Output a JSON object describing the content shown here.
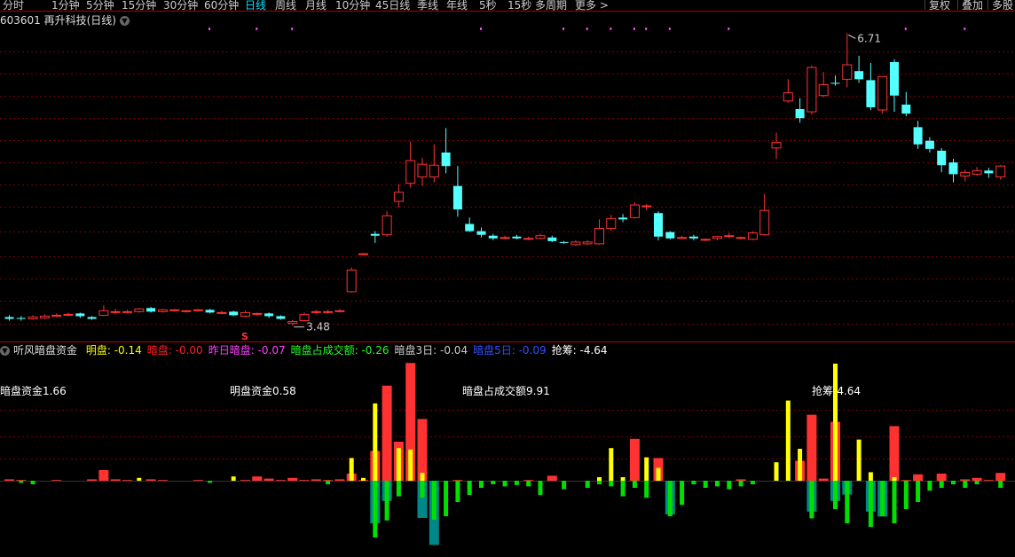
{
  "toolbar": {
    "periods": [
      "分时",
      "1分钟",
      "5分钟",
      "15分钟",
      "30分钟",
      "60分钟",
      "日线",
      "周线",
      "月线",
      "10分钟",
      "45日线",
      "季线",
      "年线",
      "5秒",
      "15秒",
      "多周期",
      "更多 >"
    ],
    "active": "日线",
    "right_buttons": [
      "复权",
      "叠加",
      "多股"
    ]
  },
  "stock": {
    "title": "603601 再升科技(日线)"
  },
  "price_chart": {
    "high_label": "6.71",
    "low_label": "3.48",
    "signal_mark": "S"
  },
  "indicator": {
    "name": "听风暗盘资金",
    "items": [
      {
        "text": "明盘: -0.14",
        "color": "#ffff00"
      },
      {
        "text": "暗盘: -0.00",
        "color": "#ff2020"
      },
      {
        "text": "昨日暗盘: -0.07",
        "color": "#ff40ff"
      },
      {
        "text": "暗盘占成交额: -0.26",
        "color": "#20ff20"
      },
      {
        "text": "暗盘3日: -0.04",
        "color": "#cccccc"
      },
      {
        "text": "暗盘5日: -0.09",
        "color": "#3050ff"
      },
      {
        "text": "抢筹: -4.64",
        "color": "#ffffff"
      }
    ],
    "annotations": [
      "暗盘资金1.66",
      "明盘资金0.58",
      "暗盘占成交额9.91",
      "抢筹-4.64"
    ]
  },
  "colors": {
    "up": "#ff3232",
    "down": "#54ffff",
    "grid": "#7a0000",
    "border": "#b00000",
    "yellow": "#ffff00",
    "green": "#00e000",
    "teal": "#008888"
  },
  "chart_data": [
    {
      "type": "candlestick",
      "title": "603601 再升科技(日线)",
      "ylim": [
        3.3,
        6.9
      ],
      "annotations": [
        {
          "label": "6.71",
          "kind": "high"
        },
        {
          "label": "3.48",
          "kind": "low"
        }
      ],
      "candles": [
        [
          3.57,
          3.55,
          3.59,
          3.53
        ],
        [
          3.56,
          3.55,
          3.58,
          3.53
        ],
        [
          3.55,
          3.57,
          3.59,
          3.54
        ],
        [
          3.56,
          3.58,
          3.6,
          3.55
        ],
        [
          3.58,
          3.59,
          3.61,
          3.57
        ],
        [
          3.6,
          3.6,
          3.62,
          3.58
        ],
        [
          3.61,
          3.58,
          3.62,
          3.56
        ],
        [
          3.57,
          3.55,
          3.58,
          3.54
        ],
        [
          3.59,
          3.64,
          3.7,
          3.58
        ],
        [
          3.63,
          3.63,
          3.66,
          3.6
        ],
        [
          3.63,
          3.63,
          3.65,
          3.61
        ],
        [
          3.63,
          3.66,
          3.67,
          3.62
        ],
        [
          3.67,
          3.63,
          3.68,
          3.62
        ],
        [
          3.63,
          3.65,
          3.66,
          3.62
        ],
        [
          3.65,
          3.65,
          3.66,
          3.63
        ],
        [
          3.63,
          3.64,
          3.65,
          3.62
        ],
        [
          3.64,
          3.65,
          3.66,
          3.63
        ],
        [
          3.65,
          3.62,
          3.66,
          3.61
        ],
        [
          3.62,
          3.62,
          3.64,
          3.6
        ],
        [
          3.63,
          3.59,
          3.64,
          3.58
        ],
        [
          3.58,
          3.62,
          3.64,
          3.57
        ],
        [
          3.6,
          3.61,
          3.62,
          3.58
        ],
        [
          3.61,
          3.58,
          3.62,
          3.56
        ],
        [
          3.58,
          3.55,
          3.59,
          3.54
        ],
        [
          3.5,
          3.52,
          3.54,
          3.48
        ],
        [
          3.53,
          3.6,
          3.62,
          3.52
        ],
        [
          3.62,
          3.63,
          3.65,
          3.6
        ],
        [
          3.63,
          3.63,
          3.65,
          3.61
        ],
        [
          3.63,
          3.64,
          3.66,
          3.62
        ],
        [
          3.85,
          4.09,
          4.12,
          3.84
        ],
        [
          4.27,
          4.27,
          4.28,
          4.27
        ],
        [
          4.49,
          4.47,
          4.52,
          4.39
        ],
        [
          4.48,
          4.69,
          4.74,
          4.46
        ],
        [
          4.85,
          4.95,
          5.04,
          4.78
        ],
        [
          5.05,
          5.3,
          5.51,
          5.0
        ],
        [
          5.12,
          5.26,
          5.33,
          5.02
        ],
        [
          5.12,
          5.25,
          5.48,
          5.06
        ],
        [
          5.39,
          5.24,
          5.66,
          5.16
        ],
        [
          5.02,
          4.76,
          5.24,
          4.68
        ],
        [
          4.6,
          4.52,
          4.67,
          4.51
        ],
        [
          4.52,
          4.48,
          4.56,
          4.45
        ],
        [
          4.47,
          4.44,
          4.49,
          4.42
        ],
        [
          4.45,
          4.45,
          4.47,
          4.43
        ],
        [
          4.46,
          4.44,
          4.48,
          4.43
        ],
        [
          4.43,
          4.44,
          4.46,
          4.42
        ],
        [
          4.44,
          4.47,
          4.49,
          4.43
        ],
        [
          4.45,
          4.41,
          4.47,
          4.4
        ],
        [
          4.4,
          4.39,
          4.41,
          4.38
        ],
        [
          4.37,
          4.4,
          4.42,
          4.36
        ],
        [
          4.38,
          4.4,
          4.42,
          4.37
        ],
        [
          4.38,
          4.55,
          4.65,
          4.37
        ],
        [
          4.55,
          4.66,
          4.7,
          4.52
        ],
        [
          4.67,
          4.65,
          4.71,
          4.62
        ],
        [
          4.67,
          4.81,
          4.84,
          4.66
        ],
        [
          4.8,
          4.8,
          4.82,
          4.75
        ],
        [
          4.72,
          4.46,
          4.74,
          4.42
        ],
        [
          4.51,
          4.44,
          4.52,
          4.43
        ],
        [
          4.45,
          4.45,
          4.47,
          4.44
        ],
        [
          4.46,
          4.44,
          4.48,
          4.42
        ],
        [
          4.42,
          4.43,
          4.44,
          4.41
        ],
        [
          4.44,
          4.46,
          4.47,
          4.42
        ],
        [
          4.46,
          4.47,
          4.5,
          4.44
        ],
        [
          4.44,
          4.45,
          4.46,
          4.43
        ],
        [
          4.43,
          4.5,
          4.52,
          4.42
        ],
        [
          4.48,
          4.75,
          4.93,
          4.47
        ],
        [
          5.44,
          5.5,
          5.61,
          5.32
        ],
        [
          5.96,
          6.05,
          6.2,
          5.94
        ],
        [
          5.87,
          5.77,
          5.99,
          5.72
        ],
        [
          5.84,
          6.33,
          6.35,
          5.81
        ],
        [
          6.02,
          6.14,
          6.28,
          6.0
        ],
        [
          6.16,
          6.15,
          6.24,
          6.13
        ],
        [
          6.2,
          6.36,
          6.71,
          6.11
        ],
        [
          6.29,
          6.2,
          6.46,
          6.16
        ],
        [
          6.19,
          5.89,
          6.38,
          5.86
        ],
        [
          5.86,
          6.23,
          6.23,
          5.82
        ],
        [
          6.39,
          6.02,
          6.42,
          5.84
        ],
        [
          5.92,
          5.82,
          6.06,
          5.79
        ],
        [
          5.67,
          5.48,
          5.74,
          5.43
        ],
        [
          5.52,
          5.43,
          5.56,
          5.39
        ],
        [
          5.41,
          5.25,
          5.44,
          5.17
        ],
        [
          5.28,
          5.15,
          5.32,
          5.06
        ],
        [
          5.13,
          5.17,
          5.2,
          5.07
        ],
        [
          5.15,
          5.19,
          5.23,
          5.13
        ],
        [
          5.19,
          5.16,
          5.22,
          5.11
        ],
        [
          5.12,
          5.24,
          5.25,
          5.09
        ]
      ]
    },
    {
      "type": "bar",
      "title": "听风暗盘资金",
      "zero_baseline": true,
      "series": [
        {
          "name": "暗盘",
          "values": [
            0.02,
            0.01,
            0,
            0,
            0.01,
            0,
            0,
            0.02,
            0.15,
            0.02,
            0.01,
            0,
            0.02,
            0.01,
            0,
            0,
            0.01,
            0,
            0,
            0,
            0.01,
            0.06,
            0.03,
            0.01,
            0.04,
            0.01,
            0.02,
            0.01,
            0.02,
            0.1,
            0.01,
            0.42,
            1.34,
            0.55,
            1.66,
            0.87,
            0,
            0,
            0.01,
            0,
            0,
            0,
            0,
            0,
            0.01,
            0,
            0.07,
            0,
            0,
            0,
            0,
            0,
            0,
            0.59,
            0,
            0.32,
            0,
            0,
            0,
            0,
            0,
            0,
            0.02,
            0,
            0,
            0,
            0,
            0.28,
            0.93,
            0.03,
            0.83,
            0,
            0,
            0,
            0,
            0.77,
            0.01,
            0.09,
            0,
            0.1,
            0,
            0.02,
            0.04,
            0.01,
            0.11
          ]
        },
        {
          "name": "明盘",
          "values": [
            0,
            0,
            0,
            0,
            0,
            0,
            0,
            0,
            0,
            0,
            0,
            0.04,
            0,
            0,
            0,
            0,
            0,
            0,
            0,
            0.06,
            0,
            0,
            0,
            0,
            0,
            0,
            0,
            0,
            0,
            0.32,
            0.04,
            1.09,
            0,
            0.46,
            0.44,
            0.11,
            0,
            0,
            0,
            0,
            0,
            0,
            0,
            0,
            0,
            0,
            0,
            0,
            0,
            0,
            0.05,
            0.46,
            0.05,
            0,
            0.33,
            0.18,
            0,
            0,
            0,
            0,
            0,
            0,
            0,
            0,
            0,
            0.26,
            1.13,
            0.45,
            0,
            0,
            1.65,
            0,
            0.58,
            0.12,
            0,
            0.05,
            0,
            0,
            0,
            0,
            0,
            0,
            0,
            0,
            0
          ]
        },
        {
          "name": "暗盘占成交额",
          "values": [
            0,
            -0.03,
            -0.05,
            0,
            0,
            0,
            0,
            0,
            0,
            0,
            0,
            0,
            0,
            0,
            0,
            0,
            0,
            -0.03,
            0,
            0,
            0,
            0,
            0,
            0,
            0,
            0,
            0,
            -0.05,
            0,
            0,
            0,
            -0.8,
            -0.56,
            -0.22,
            0,
            -0.24,
            -0.55,
            -0.5,
            -0.3,
            -0.2,
            -0.1,
            -0.05,
            -0.08,
            -0.06,
            -0.08,
            -0.2,
            0,
            -0.12,
            0,
            -0.1,
            -0.05,
            -0.08,
            -0.22,
            -0.1,
            -0.24,
            0,
            -0.5,
            -0.34,
            -0.05,
            -0.1,
            -0.08,
            -0.12,
            -0.08,
            -0.05,
            0,
            0,
            0,
            0,
            -0.53,
            0,
            -0.4,
            -0.6,
            0,
            -0.65,
            -0.5,
            -0.6,
            -0.4,
            -0.3,
            -0.14,
            -0.1,
            -0.05,
            -0.1,
            -0.05,
            0,
            -0.1
          ]
        },
        {
          "name": "抢筹",
          "values": [
            0,
            0,
            0,
            0,
            0,
            0,
            0,
            0,
            0,
            0,
            0,
            0,
            0,
            0,
            0,
            0,
            0,
            0,
            0,
            0,
            0,
            0,
            0,
            0,
            0,
            0,
            0,
            0,
            0,
            0,
            0,
            -1.2,
            -0.57,
            0,
            0,
            -1.05,
            -1.81,
            0,
            0,
            0,
            0,
            0,
            0,
            0,
            0,
            0,
            0,
            0,
            0,
            0,
            0,
            0,
            0,
            0,
            0,
            0,
            -0.95,
            0,
            0,
            0,
            0,
            0,
            0,
            0,
            0,
            0,
            0,
            0,
            -0.87,
            0,
            -0.57,
            -0.39,
            0,
            -0.87,
            -1.01,
            0,
            0,
            0,
            0,
            0,
            0,
            0,
            0,
            0,
            0
          ]
        }
      ]
    }
  ]
}
